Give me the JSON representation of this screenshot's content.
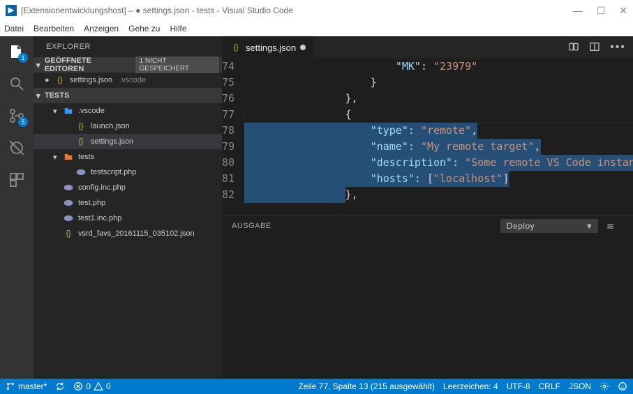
{
  "window": {
    "title": "[Extensionentwicklungshost] – ● settings.json - tests - Visual Studio Code"
  },
  "menu": {
    "items": [
      "Datei",
      "Bearbeiten",
      "Anzeigen",
      "Gehe zu",
      "Hilfe"
    ]
  },
  "activity": {
    "files_badge": "1",
    "debug_badge": "5"
  },
  "sidebar": {
    "title": "EXPLORER",
    "open_editors_label": "GEÖFFNETE EDITOREN",
    "unsaved_label": "1 NICHT GESPEICHERT",
    "open_editor": {
      "name": "settings.json",
      "folder": ".vscode"
    },
    "workspace_label": "TESTS",
    "tree": [
      {
        "label": ".vscode",
        "type": "folder",
        "depth": 1,
        "children": [
          {
            "label": "launch.json",
            "type": "json",
            "depth": 2
          },
          {
            "label": "settings.json",
            "type": "json",
            "depth": 2,
            "selected": true
          }
        ]
      },
      {
        "label": "tests",
        "type": "folder-git",
        "depth": 1,
        "children": [
          {
            "label": "testscript.php",
            "type": "php",
            "depth": 2
          }
        ]
      },
      {
        "label": "config.inc.php",
        "type": "php",
        "depth": 1
      },
      {
        "label": "test.php",
        "type": "php",
        "depth": 1
      },
      {
        "label": "test1.inc.php",
        "type": "php",
        "depth": 1
      },
      {
        "label": "vsrd_favs_20161115_035102.json",
        "type": "json",
        "depth": 1
      }
    ]
  },
  "tabs": {
    "active": {
      "label": "settings.json",
      "dirty": true
    }
  },
  "code": {
    "first_line": 74,
    "lines": [
      {
        "indent": 24,
        "tokens": [
          {
            "t": "prop",
            "v": "\"MK\""
          },
          {
            "t": "punc",
            "v": ": "
          },
          {
            "t": "str",
            "v": "\"23979\""
          }
        ]
      },
      {
        "indent": 20,
        "tokens": [
          {
            "t": "brk",
            "v": "}"
          }
        ]
      },
      {
        "indent": 16,
        "tokens": [
          {
            "t": "brk",
            "v": "}"
          },
          {
            "t": "punc",
            "v": ","
          }
        ]
      },
      {
        "indent": 16,
        "tokens": [
          {
            "t": "brk",
            "v": "{"
          }
        ],
        "hl": true
      },
      {
        "indent": 20,
        "sel": true,
        "tokens": [
          {
            "t": "prop",
            "v": "\"type\""
          },
          {
            "t": "punc",
            "v": ": "
          },
          {
            "t": "str",
            "v": "\"remote\""
          },
          {
            "t": "punc",
            "v": ","
          }
        ]
      },
      {
        "indent": 20,
        "sel": true,
        "tokens": [
          {
            "t": "prop",
            "v": "\"name\""
          },
          {
            "t": "punc",
            "v": ": "
          },
          {
            "t": "str",
            "v": "\"My remote target\""
          },
          {
            "t": "punc",
            "v": ","
          }
        ]
      },
      {
        "indent": 20,
        "sel": true,
        "tokens": [
          {
            "t": "prop",
            "v": "\"description\""
          },
          {
            "t": "punc",
            "v": ": "
          },
          {
            "t": "str",
            "v": "\"Some remote VS Code instances"
          }
        ]
      },
      {
        "indent": 20,
        "sel": true,
        "tokens": [
          {
            "t": "prop",
            "v": "\"hosts\""
          },
          {
            "t": "punc",
            "v": ": "
          },
          {
            "t": "brk",
            "v": "["
          },
          {
            "t": "str",
            "v": "\"localhost\""
          },
          {
            "t": "brk",
            "v": "]"
          }
        ]
      },
      {
        "indent": 16,
        "tokens": [
          {
            "t": "brk",
            "v": "}"
          },
          {
            "t": "punc",
            "v": ","
          }
        ],
        "sel_leading": true
      }
    ]
  },
  "panel": {
    "tab": "AUSGABE",
    "dropdown": "Deploy"
  },
  "status": {
    "branch": "master*",
    "errors": "0",
    "warnings": "0",
    "cursor": "Zeile 77, Spalte 13 (215 ausgewählt)",
    "spaces": "Leerzeichen: 4",
    "encoding": "UTF-8",
    "eol": "CRLF",
    "lang": "JSON"
  }
}
